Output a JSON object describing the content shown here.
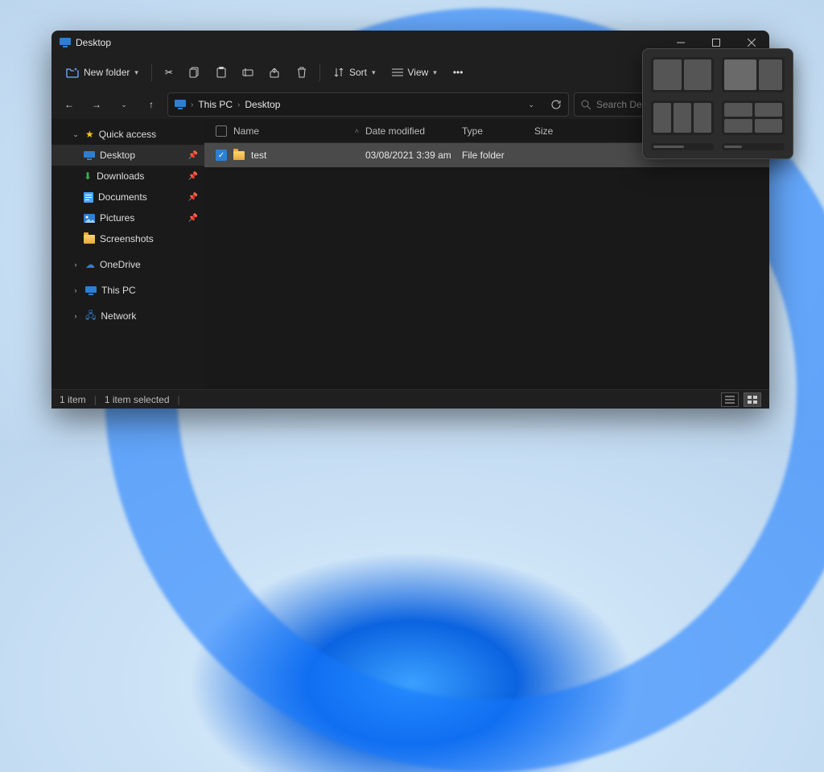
{
  "title": "Desktop",
  "toolbar": {
    "new_label": "New folder",
    "sort_label": "Sort",
    "view_label": "View"
  },
  "breadcrumb": {
    "root": "This PC",
    "current": "Desktop"
  },
  "search": {
    "placeholder": "Search Desktop"
  },
  "sidebar": {
    "quick": "Quick access",
    "items": [
      {
        "label": "Desktop"
      },
      {
        "label": "Downloads"
      },
      {
        "label": "Documents"
      },
      {
        "label": "Pictures"
      },
      {
        "label": "Screenshots"
      }
    ],
    "onedrive": "OneDrive",
    "thispc": "This PC",
    "network": "Network"
  },
  "columns": {
    "name": "Name",
    "date": "Date modified",
    "type": "Type",
    "size": "Size"
  },
  "rows": [
    {
      "name": "test",
      "date": "03/08/2021 3:39 am",
      "type": "File folder",
      "size": ""
    }
  ],
  "status": {
    "count": "1 item",
    "selected": "1 item selected"
  }
}
